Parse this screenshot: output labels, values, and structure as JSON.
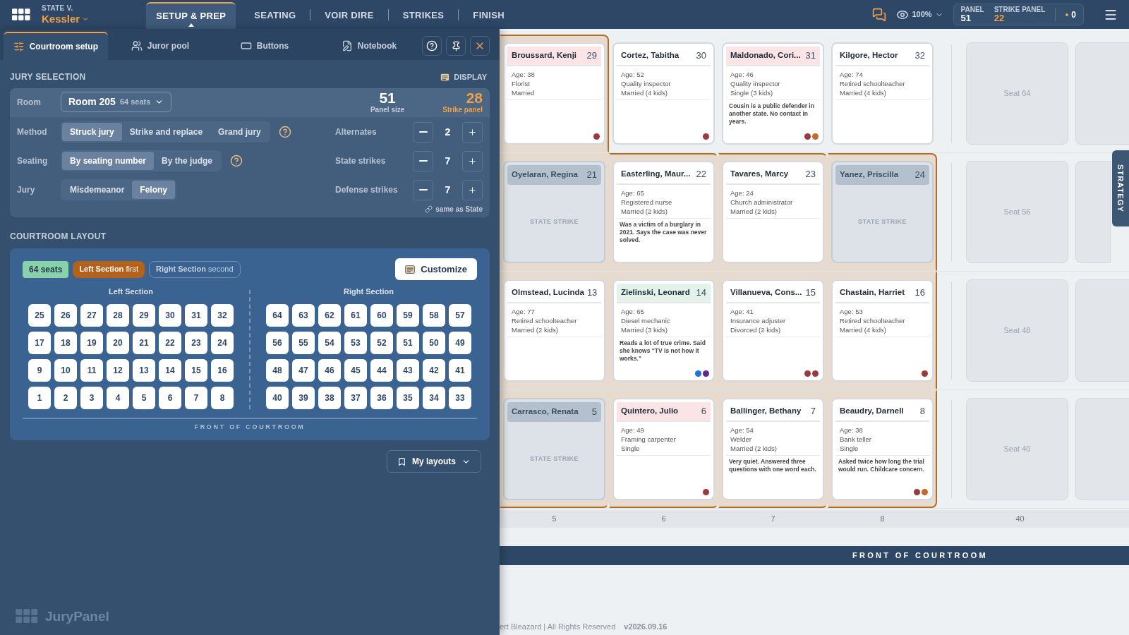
{
  "header": {
    "case_label": "STATE V.",
    "case_name": "Kessler",
    "nav": [
      {
        "label": "SETUP & PREP",
        "selected": true
      },
      {
        "label": "SEATING",
        "selected": false
      },
      {
        "label": "VOIR DIRE",
        "selected": false
      },
      {
        "label": "STRIKES",
        "selected": false
      },
      {
        "label": "FINISH",
        "selected": false
      }
    ],
    "zoom": "100%",
    "panel_label": "PANEL",
    "panel_value": "51",
    "strike_label": "STRIKE PANEL",
    "strike_value": "22",
    "count": "0"
  },
  "panel": {
    "tabs": [
      {
        "label": "Courtroom setup",
        "selected": true
      },
      {
        "label": "Juror pool",
        "selected": false
      },
      {
        "label": "Buttons",
        "selected": false
      },
      {
        "label": "Notebook",
        "selected": false
      }
    ],
    "jury_selection": {
      "title": "JURY SELECTION",
      "display_label": "DISPLAY",
      "room_label": "Room",
      "room_value": "Room 205",
      "room_seats": "64 seats",
      "panel_size": {
        "value": "51",
        "label": "Panel size"
      },
      "strike_panel": {
        "value": "28",
        "label": "Strike panel"
      },
      "options": [
        {
          "label": "Method",
          "help": true,
          "choices": [
            {
              "label": "Struck jury",
              "selected": true
            },
            {
              "label": "Strike and replace",
              "selected": false
            },
            {
              "label": "Grand jury",
              "selected": false
            }
          ]
        },
        {
          "label": "Seating",
          "help": true,
          "choices": [
            {
              "label": "By seating number",
              "selected": true
            },
            {
              "label": "By the judge",
              "selected": false
            }
          ]
        },
        {
          "label": "Jury",
          "help": false,
          "choices": [
            {
              "label": "Misdemeanor",
              "selected": false
            },
            {
              "label": "Felony",
              "selected": true
            }
          ]
        }
      ],
      "counters": [
        {
          "label": "Alternates",
          "value": "2"
        },
        {
          "label": "State strikes",
          "value": "7"
        },
        {
          "label": "Defense strikes",
          "value": "7"
        }
      ],
      "link_note": "same as State"
    },
    "layout": {
      "title": "COURTROOM LAYOUT",
      "seat_count": "64 seats",
      "first": "**Left Section** first",
      "second": "**Right Section** second",
      "customize": "Customize",
      "sections": [
        {
          "title": "Left Section",
          "rows": [
            [
              "25",
              "26",
              "27",
              "28",
              "29",
              "30",
              "31",
              "32"
            ],
            [
              "17",
              "18",
              "19",
              "20",
              "21",
              "22",
              "23",
              "24"
            ],
            [
              "9",
              "10",
              "11",
              "12",
              "13",
              "14",
              "15",
              "16"
            ],
            [
              "1",
              "2",
              "3",
              "4",
              "5",
              "6",
              "7",
              "8"
            ]
          ]
        },
        {
          "title": "Right Section",
          "rows": [
            [
              "64",
              "63",
              "62",
              "61",
              "60",
              "59",
              "58",
              "57"
            ],
            [
              "56",
              "55",
              "54",
              "53",
              "52",
              "51",
              "50",
              "49"
            ],
            [
              "48",
              "47",
              "46",
              "45",
              "44",
              "43",
              "42",
              "41"
            ],
            [
              "40",
              "39",
              "38",
              "37",
              "36",
              "35",
              "34",
              "33"
            ]
          ]
        }
      ],
      "front_label": "FRONT OF COURTROOM"
    },
    "my_layouts": "My layouts",
    "brand": "JuryPanel"
  },
  "courtroom": {
    "rows": [
      {
        "cells": [
          {
            "kind": "juror",
            "in_panel": true,
            "name": "Broussard, Kenji",
            "seat": "29",
            "color": "#fbe4e5",
            "age": "Age: 38",
            "occupation": "Florist",
            "family": "Married",
            "dots": [
              {
                "color": "#9b3a3e"
              }
            ]
          },
          {
            "kind": "juror",
            "in_panel": false,
            "name": "Cortez, Tabitha",
            "seat": "30",
            "color": "#ffffff",
            "age": "Age: 52",
            "occupation": "Quality inspector",
            "family": "Married (4 kids)",
            "dots": [
              {
                "color": "#9b3a3e"
              }
            ]
          },
          {
            "kind": "juror",
            "in_panel": false,
            "name": "Maldonado, Cori...",
            "seat": "31",
            "color": "#fbe4e5",
            "age": "Age: 46",
            "occupation": "Quality inspector",
            "family": "Single (3 kids)",
            "note": "Cousin is a public defender in another state. No contact in years.",
            "dots": [
              {
                "color": "#9b3a3e"
              },
              {
                "color": "#c4692c"
              }
            ]
          },
          {
            "kind": "juror",
            "in_panel": false,
            "name": "Kilgore, Hector",
            "seat": "32",
            "color": "#ffffff",
            "age": "Age: 74",
            "occupation": "Retired schoolteacher",
            "family": "Married (4 kids)"
          }
        ],
        "seats": [
          "Seat 64"
        ]
      },
      {
        "cells": [
          {
            "kind": "strike",
            "in_panel": true,
            "name": "Oyelaran, Regina",
            "seat": "21",
            "strike_label": "STATE STRIKE"
          },
          {
            "kind": "juror",
            "in_panel": true,
            "name": "Easterling, Maur...",
            "seat": "22",
            "color": "#ffffff",
            "age": "Age: 65",
            "occupation": "Registered nurse",
            "family": "Married (2 kids)",
            "note": "Was a victim of a burglary in 2021. Says the case was never solved."
          },
          {
            "kind": "juror",
            "in_panel": true,
            "name": "Tavares, Marcy",
            "seat": "23",
            "color": "#ffffff",
            "age": "Age: 24",
            "occupation": "Church administrator",
            "family": "Married (2 kids)"
          },
          {
            "kind": "strike",
            "in_panel": true,
            "name": "Yanez, Priscilla",
            "seat": "24",
            "strike_label": "STATE STRIKE"
          }
        ],
        "seats": [
          "Seat 56"
        ]
      },
      {
        "cells": [
          {
            "kind": "juror",
            "in_panel": true,
            "name": "Olmstead, Lucinda",
            "seat": "13",
            "color": "#ffffff",
            "age": "Age: 77",
            "occupation": "Retired schoolteacher",
            "family": "Married (2 kids)"
          },
          {
            "kind": "juror",
            "in_panel": true,
            "name": "Zielinski, Leonard",
            "seat": "14",
            "color": "#e3f3ea",
            "age": "Age: 65",
            "occupation": "Diesel mechanic",
            "family": "Married (3 kids)",
            "note": "Reads a lot of true crime. Said she knows \"TV is not how it works.\"",
            "dots": [
              {
                "color": "#1f6fe5"
              },
              {
                "color": "#5a2a8c"
              }
            ]
          },
          {
            "kind": "juror",
            "in_panel": true,
            "name": "Villanueva, Cons...",
            "seat": "15",
            "color": "#ffffff",
            "age": "Age: 41",
            "occupation": "Insurance adjuster",
            "family": "Divorced (2 kids)",
            "dots": [
              {
                "color": "#9b3a3e"
              },
              {
                "color": "#9b3a3e"
              }
            ]
          },
          {
            "kind": "juror",
            "in_panel": true,
            "name": "Chastain, Harriet",
            "seat": "16",
            "color": "#ffffff",
            "age": "Age: 53",
            "occupation": "Retired schoolteacher",
            "family": "Married (4 kids)",
            "dots": [
              {
                "color": "#9b3a3e"
              }
            ]
          }
        ],
        "seats": [
          "Seat 48"
        ]
      },
      {
        "cells": [
          {
            "kind": "strike",
            "in_panel": true,
            "name": "Carrasco, Renata",
            "seat": "5",
            "strike_label": "STATE STRIKE"
          },
          {
            "kind": "juror",
            "in_panel": true,
            "name": "Quintero, Julio",
            "seat": "6",
            "color": "#fbe4e5",
            "age": "Age: 49",
            "occupation": "Framing carpenter",
            "family": "Single",
            "dots": [
              {
                "color": "#9b3a3e"
              }
            ]
          },
          {
            "kind": "juror",
            "in_panel": true,
            "name": "Ballinger, Bethany",
            "seat": "7",
            "color": "#ffffff",
            "age": "Age: 54",
            "occupation": "Welder",
            "family": "Married (2 kids)",
            "note": "Very quiet. Answered three questions with one word each."
          },
          {
            "kind": "juror",
            "in_panel": true,
            "name": "Beaudry, Darnell",
            "seat": "8",
            "color": "#ffffff",
            "age": "Age: 38",
            "occupation": "Bank teller",
            "family": "Single",
            "note": "Asked twice how long the trial would run. Childcare concern.",
            "dots": [
              {
                "color": "#9b3a3e"
              },
              {
                "color": "#c4692c"
              }
            ]
          }
        ],
        "seats": [
          "Seat 40"
        ]
      }
    ],
    "seat_numbers": [
      "5",
      "6",
      "7",
      "8",
      "40"
    ],
    "front_label": "FRONT OF COURTROOM",
    "strategy_tab": "STRATEGY"
  },
  "footer": {
    "copyright": "ert Bleazard | All Rights Reserved",
    "version": "v2026.09.16"
  }
}
